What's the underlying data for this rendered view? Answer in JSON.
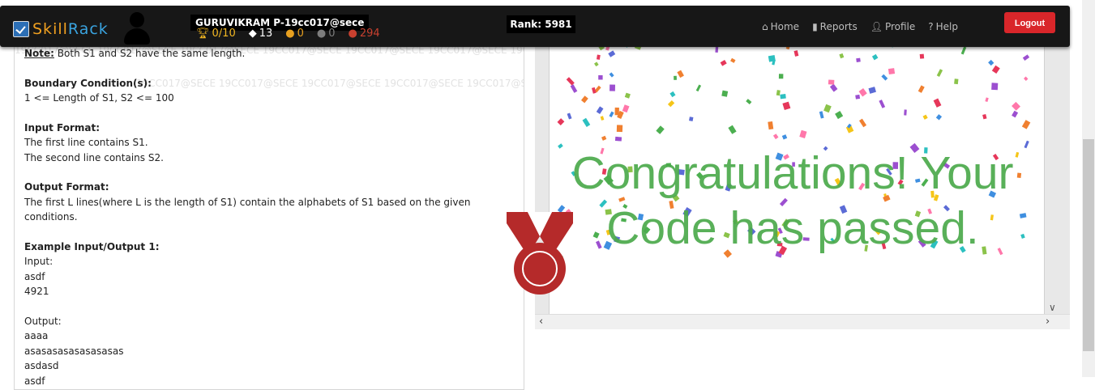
{
  "header": {
    "logo": {
      "part1": "Skill",
      "part2": "Rack"
    },
    "username": "GURUVIKRAM P-19cc017@sece",
    "stats": [
      {
        "icon": "trophy-icon",
        "value": "0/10",
        "color": "#f2b722"
      },
      {
        "icon": "graduation-cap-icon",
        "value": "13",
        "color": "#ffffff"
      },
      {
        "icon": "bronze-medal-icon",
        "value": "0",
        "color": "#e8a020"
      },
      {
        "icon": "silver-medal-icon",
        "value": "0",
        "color": "#7d7d7d"
      },
      {
        "icon": "red-medal-icon",
        "value": "294",
        "color": "#c8402f"
      }
    ],
    "rank": "Rank: 5981",
    "nav": [
      {
        "label": "Home",
        "icon": "home-icon"
      },
      {
        "label": "Reports",
        "icon": "bar-chart-icon"
      },
      {
        "label": "Profile",
        "icon": "user-icon"
      },
      {
        "label": "Help",
        "icon": "question-icon"
      }
    ],
    "logout_label": "Logout"
  },
  "problem": {
    "watermark": "19CC017@SECE 19CC017@SECE 19CC017@SECE 19CC017@SECE 19CC017@SECE 19CC017@SECE 19CC017@SECE",
    "note_label": "Note:",
    "note_text": " Both S1 and S2 have the same length.",
    "boundary_heading": "Boundary Condition(s):",
    "boundary_text": "1 <= Length of S1, S2 <= 100",
    "input_heading": "Input Format:",
    "input_lines": [
      "The first line contains S1.",
      "The second line contains S2."
    ],
    "output_heading": "Output Format:",
    "output_text": "The first L lines(where L is the length of S1) contain the alphabets of S1 based on the given conditions.",
    "example_heading": "Example Input/Output 1:",
    "input_label": "Input:",
    "input_values": [
      "asdf",
      "4921"
    ],
    "output_label": "Output:",
    "output_values": [
      "aaaa",
      "asasasasasasasasas",
      "asdasd",
      "asdf"
    ]
  },
  "result": {
    "message_line1": "Congratulations! Your",
    "message_line2": "Code has passed.",
    "message_color": "#4caa4c",
    "medal_color": "#b52a2a"
  }
}
